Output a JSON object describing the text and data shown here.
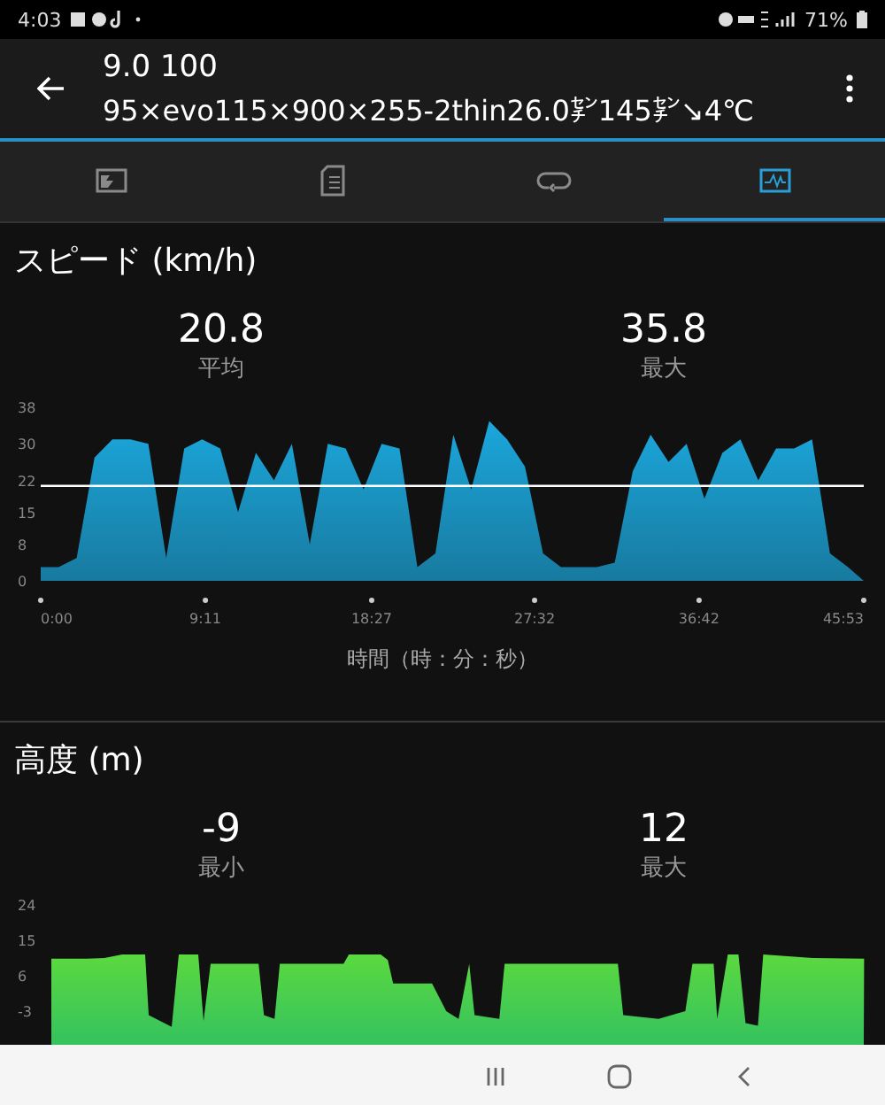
{
  "status_bar": {
    "time": "4:03",
    "battery": "71%"
  },
  "header": {
    "title": "9.0 100",
    "subtitle": "95×evo115×900×255-2thin26.0㌢145㌢↘4℃"
  },
  "tabs": [
    {
      "kind": "photo",
      "selected": false
    },
    {
      "kind": "document",
      "selected": false
    },
    {
      "kind": "loop",
      "selected": false
    },
    {
      "kind": "chart",
      "selected": true
    }
  ],
  "sections": [
    {
      "title": "スピード (km/h)",
      "stats": [
        {
          "value": "20.8",
          "label": "平均"
        },
        {
          "value": "35.8",
          "label": "最大"
        }
      ],
      "chart_data": {
        "type": "area",
        "xlabel": "時間（時：分：秒）",
        "x": [
          0,
          1,
          2,
          3,
          4,
          5,
          6,
          7,
          8,
          9,
          10,
          11,
          12,
          13,
          14,
          15,
          16,
          17,
          18,
          19,
          20,
          21,
          22,
          23,
          24,
          25,
          26,
          27,
          28,
          29,
          30,
          31,
          32,
          33,
          34,
          35,
          36,
          37,
          38,
          39,
          40,
          41,
          42,
          43,
          44,
          45,
          45.88
        ],
        "series": [
          {
            "color": "#1ba7dc",
            "values": [
              3,
              3,
              5,
              27,
              31,
              31,
              30,
              5,
              29,
              31,
              29,
              15,
              28,
              22,
              30,
              8,
              30,
              29,
              20,
              30,
              29,
              3,
              6,
              32,
              20,
              35,
              31,
              25,
              6,
              3,
              3,
              3,
              4,
              24,
              32,
              26,
              30,
              18,
              28,
              31,
              22,
              29,
              29,
              31,
              6,
              3,
              0
            ]
          },
          {
            "type": "line",
            "color": "#ffffff",
            "values": [
              20.8,
              20.8,
              20.8,
              20.8,
              20.8,
              20.8,
              20.8,
              20.8,
              20.8,
              20.8,
              20.8,
              20.8,
              20.8,
              20.8,
              20.8,
              20.8,
              20.8,
              20.8,
              20.8,
              20.8,
              20.8,
              20.8,
              20.8,
              20.8,
              20.8,
              20.8,
              20.8,
              20.8,
              20.8,
              20.8,
              20.8,
              20.8,
              20.8,
              20.8,
              20.8,
              20.8,
              20.8,
              20.8,
              20.8,
              20.8,
              20.8,
              20.8,
              20.8,
              20.8,
              20.8,
              20.8,
              20.8
            ]
          }
        ],
        "xlim": [
          0,
          45.88
        ],
        "ylim": [
          0,
          38
        ],
        "xticks": [
          {
            "value": 0,
            "label": "0:00"
          },
          {
            "value": 9.18,
            "label": "9:11"
          },
          {
            "value": 18.45,
            "label": "18:27"
          },
          {
            "value": 27.53,
            "label": "27:32"
          },
          {
            "value": 36.7,
            "label": "36:42"
          },
          {
            "value": 45.88,
            "label": "45:53"
          }
        ],
        "yticks": [
          0,
          8,
          15,
          22,
          30,
          38
        ]
      }
    },
    {
      "title": "高度 (m)",
      "stats": [
        {
          "value": "-9",
          "label": "最小"
        },
        {
          "value": "12",
          "label": "最大"
        }
      ],
      "chart_picture": {
        "kind": "area",
        "y_labels": [
          "24",
          "15",
          "6",
          "-3"
        ]
      }
    }
  ]
}
